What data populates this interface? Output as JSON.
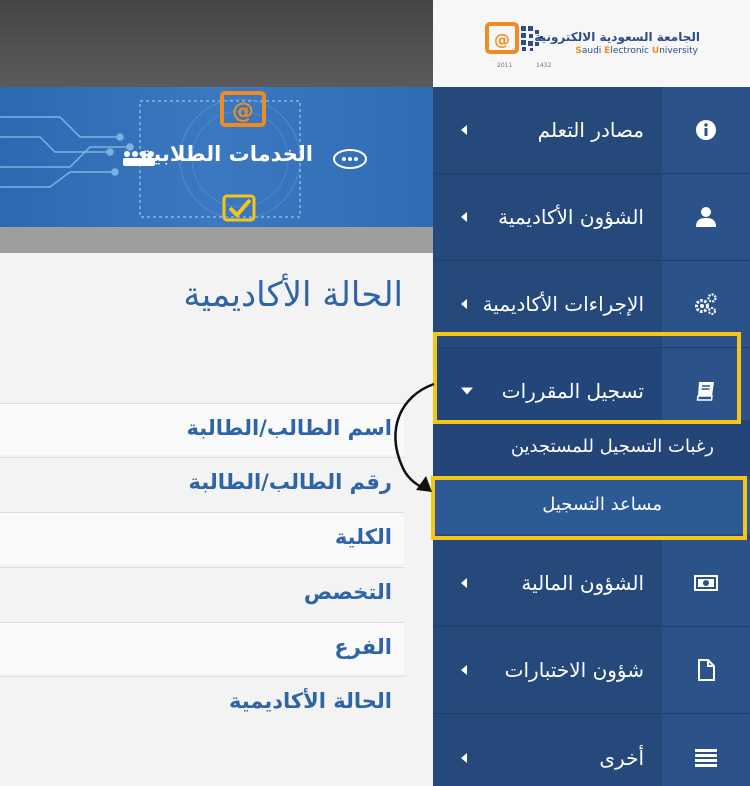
{
  "university": {
    "name_ar": "الجامعة السعودية الالكترونية",
    "name_en_parts": [
      "S",
      "audi ",
      "E",
      "lectronic ",
      "U",
      "niversity"
    ],
    "year_left": "2011",
    "year_right": "1432"
  },
  "banner": {
    "title": "الخدمات الطلابية"
  },
  "main": {
    "page_title": "الحالة الأكاديمية",
    "fields": [
      "اسم الطالب/الطالبة",
      "رقم الطالب/الطالبة",
      "الكلية",
      "التخصص",
      "الفرع",
      "الحالة الأكاديمية"
    ]
  },
  "sidebar": {
    "items": [
      {
        "label": "مصادر التعلم",
        "icon": "info-icon"
      },
      {
        "label": "الشؤون الأكاديمية",
        "icon": "user-icon"
      },
      {
        "label": "الإجراءات الأكاديمية",
        "icon": "gears-icon"
      },
      {
        "label": "تسجيل المقررات",
        "icon": "book-icon"
      },
      {
        "label": "الشؤون المالية",
        "icon": "money-icon"
      },
      {
        "label": "شؤون الاختبارات",
        "icon": "file-icon"
      },
      {
        "label": "أخرى",
        "icon": "list-icon"
      }
    ],
    "sub_items": [
      {
        "label": "رغبات التسجيل للمستجدين"
      },
      {
        "label": "مساعد التسجيل"
      }
    ]
  },
  "colors": {
    "sidebar_bg": "#26497c",
    "icon_column": "#2c5389",
    "highlight": "#f5c518",
    "text_blue": "#2f64a7",
    "banner_blue": "#3b78c0"
  }
}
